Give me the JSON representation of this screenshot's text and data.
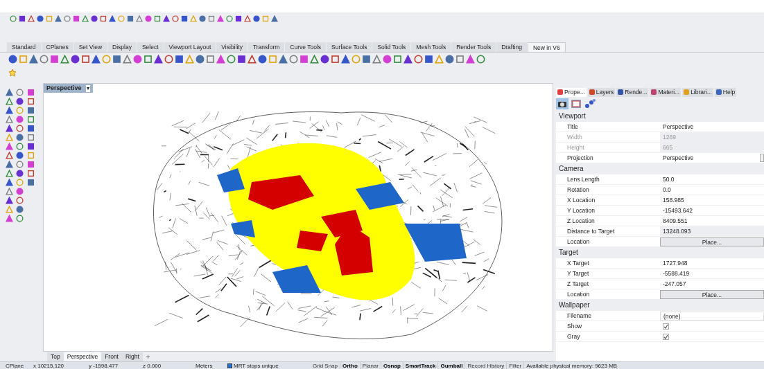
{
  "ribbon_tabs": [
    {
      "label": "Standard",
      "selected": false
    },
    {
      "label": "CPlanes",
      "selected": false
    },
    {
      "label": "Set View",
      "selected": false
    },
    {
      "label": "Display",
      "selected": false
    },
    {
      "label": "Select",
      "selected": false
    },
    {
      "label": "Viewport Layout",
      "selected": false
    },
    {
      "label": "Visibility",
      "selected": false
    },
    {
      "label": "Transform",
      "selected": false
    },
    {
      "label": "Curve Tools",
      "selected": false
    },
    {
      "label": "Surface Tools",
      "selected": false
    },
    {
      "label": "Solid Tools",
      "selected": false
    },
    {
      "label": "Mesh Tools",
      "selected": false
    },
    {
      "label": "Render Tools",
      "selected": false
    },
    {
      "label": "Drafting",
      "selected": false
    },
    {
      "label": "New in V6",
      "selected": true
    }
  ],
  "viewport": {
    "title": "Perspective",
    "menu_glyph": "▾"
  },
  "viewport_tabs": [
    {
      "label": "Top",
      "selected": false
    },
    {
      "label": "Perspective",
      "selected": true
    },
    {
      "label": "Front",
      "selected": false
    },
    {
      "label": "Right",
      "selected": false
    }
  ],
  "add_tab": "+",
  "panel_tabs": [
    {
      "label": "Prope...",
      "selected": true
    },
    {
      "label": "Layers",
      "selected": false
    },
    {
      "label": "Rende...",
      "selected": false
    },
    {
      "label": "Materi...",
      "selected": false
    },
    {
      "label": "Librari...",
      "selected": false
    },
    {
      "label": "Help",
      "selected": false
    }
  ],
  "sections": [
    {
      "title": "Viewport",
      "rows": [
        {
          "kind": "text",
          "label": "Title",
          "value": "Perspective"
        },
        {
          "kind": "disabled",
          "label": "Width",
          "value": "1269"
        },
        {
          "kind": "disabled",
          "label": "Height",
          "value": "665"
        },
        {
          "kind": "dropdown",
          "label": "Projection",
          "value": "Perspective"
        }
      ]
    },
    {
      "title": "Camera",
      "rows": [
        {
          "kind": "text",
          "label": "Lens Length",
          "value": "50.0"
        },
        {
          "kind": "text",
          "label": "Rotation",
          "value": "0.0"
        },
        {
          "kind": "text",
          "label": "X Location",
          "value": "158.985"
        },
        {
          "kind": "text",
          "label": "Y Location",
          "value": "-15493.642"
        },
        {
          "kind": "text",
          "label": "Z Location",
          "value": "8409.551"
        },
        {
          "kind": "disabled",
          "label": "Distance to Target",
          "value": "13248.093"
        },
        {
          "kind": "button",
          "label": "Location",
          "value": "Place..."
        }
      ]
    },
    {
      "title": "Target",
      "rows": [
        {
          "kind": "text",
          "label": "X Target",
          "value": "1727.948"
        },
        {
          "kind": "text",
          "label": "Y Target",
          "value": "-5588.419"
        },
        {
          "kind": "text",
          "label": "Z Target",
          "value": "-247.057"
        },
        {
          "kind": "button",
          "label": "Location",
          "value": "Place..."
        }
      ]
    },
    {
      "title": "Wallpaper",
      "rows": [
        {
          "kind": "file",
          "label": "Filename",
          "value": "(none)"
        },
        {
          "kind": "checkbox",
          "label": "Show",
          "checked": true
        },
        {
          "kind": "checkbox",
          "label": "Gray",
          "checked": true
        }
      ]
    }
  ],
  "status_bar": {
    "cplane": "CPlane",
    "x": "x 10215.120",
    "y": "y -1598.477",
    "z": "z 0.000",
    "units": "Meters",
    "layer": {
      "name": "MRT stops unique",
      "color": "#1e73d8"
    },
    "toggles": [
      {
        "label": "Grid Snap",
        "on": false
      },
      {
        "label": "Ortho",
        "on": true
      },
      {
        "label": "Planar",
        "on": false
      },
      {
        "label": "Osnap",
        "on": true
      },
      {
        "label": "SmartTrack",
        "on": true
      },
      {
        "label": "Gumball",
        "on": true
      },
      {
        "label": "Record History",
        "on": false
      },
      {
        "label": "Filter",
        "on": false
      }
    ],
    "memory": "Available physical memory: 9623 MB"
  }
}
